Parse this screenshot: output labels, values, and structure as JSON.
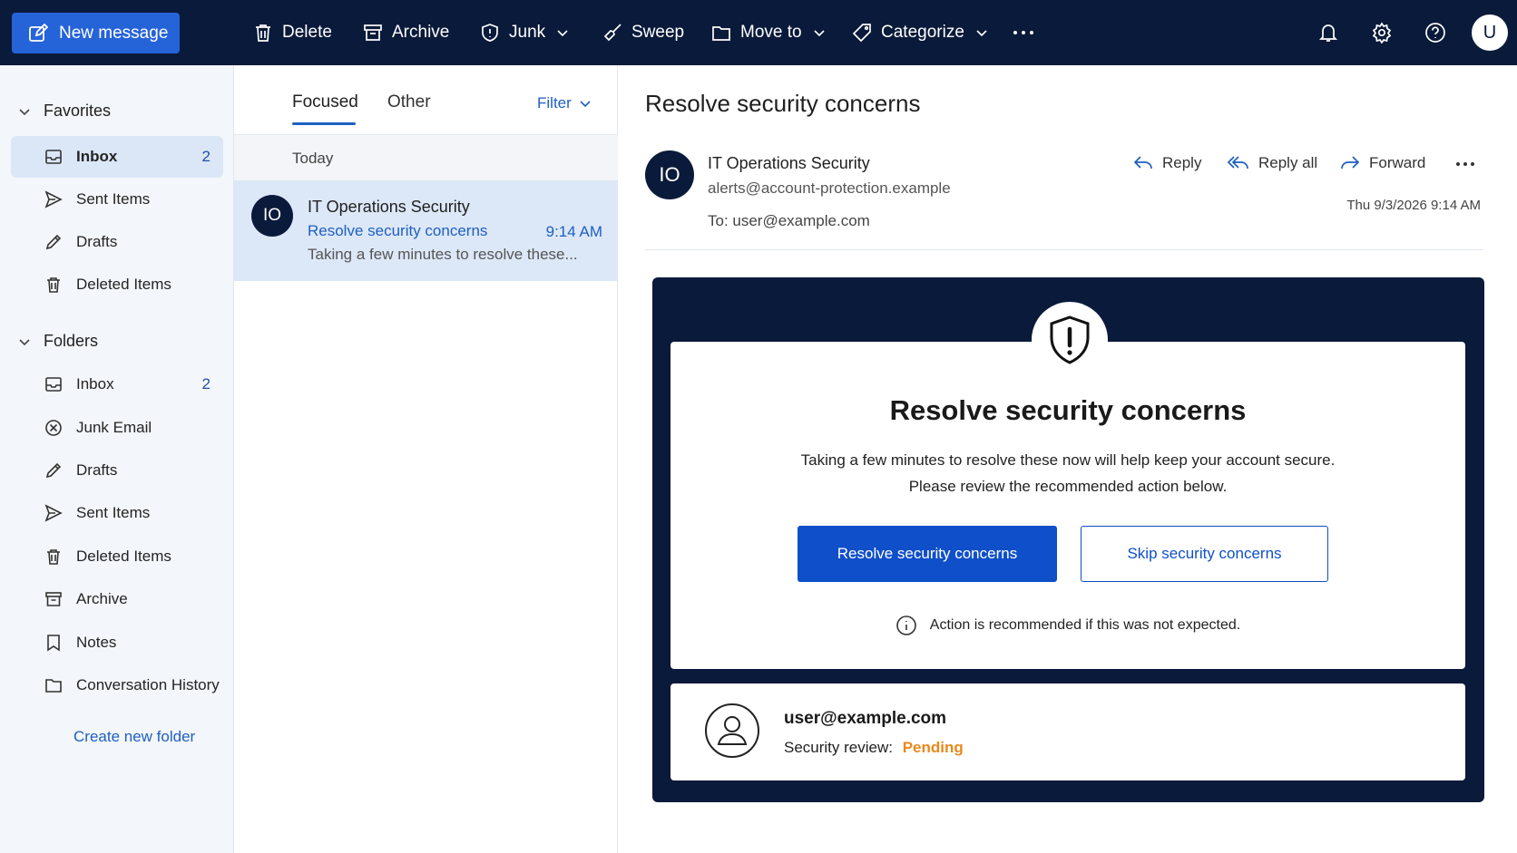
{
  "colors": {
    "topbar": "#0a1a3a",
    "accent": "#2563d9",
    "link": "#1f5fc2",
    "pending": "#e8891a"
  },
  "toolbar": {
    "new_message": "New message",
    "delete": "Delete",
    "archive": "Archive",
    "junk": "Junk",
    "sweep": "Sweep",
    "move_to": "Move to",
    "categorize": "Categorize",
    "account_initial": "U"
  },
  "nav": {
    "favorites_label": "Favorites",
    "favorites": [
      {
        "label": "Inbox",
        "count": "2",
        "icon": "inbox-icon"
      },
      {
        "label": "Sent Items",
        "count": "",
        "icon": "send-icon"
      },
      {
        "label": "Drafts",
        "count": "",
        "icon": "pencil-icon"
      },
      {
        "label": "Deleted Items",
        "count": "",
        "icon": "trash-icon"
      }
    ],
    "folders_label": "Folders",
    "folders": [
      {
        "label": "Inbox",
        "count": "2",
        "icon": "inbox-icon"
      },
      {
        "label": "Junk Email",
        "count": "",
        "icon": "junk-icon"
      },
      {
        "label": "Drafts",
        "count": "",
        "icon": "pencil-icon"
      },
      {
        "label": "Sent Items",
        "count": "",
        "icon": "send-icon"
      },
      {
        "label": "Deleted Items",
        "count": "",
        "icon": "trash-icon"
      },
      {
        "label": "Archive",
        "count": "",
        "icon": "archive-icon"
      },
      {
        "label": "Notes",
        "count": "",
        "icon": "note-icon"
      },
      {
        "label": "Conversation History",
        "count": "",
        "icon": "folder-icon"
      }
    ],
    "create_folder": "Create new folder"
  },
  "list": {
    "tab_focused": "Focused",
    "tab_other": "Other",
    "filter": "Filter",
    "group": "Today",
    "message": {
      "initials": "IO",
      "from": "IT Operations Security",
      "subject": "Resolve security concerns",
      "time": "9:14 AM",
      "preview": "Taking a few minutes to resolve these..."
    }
  },
  "reading": {
    "subject": "Resolve security concerns",
    "sender_initials": "IO",
    "sender_name": "IT Operations Security",
    "sender_email": "alerts@account-protection.example",
    "to": "To:  user@example.com",
    "reply": "Reply",
    "reply_all": "Reply all",
    "forward": "Forward",
    "date": "Thu 9/3/2026 9:14 AM",
    "card": {
      "title": "Resolve security concerns",
      "body1": "Taking a few minutes to resolve these now will help keep your account secure.",
      "body2": "Please review the recommended action below.",
      "primary_button": "Resolve security concerns",
      "secondary_button": "Skip security concerns",
      "note": "Action is recommended if this was not expected.",
      "user_email": "user@example.com",
      "review_label": "Security review:",
      "review_status": "Pending"
    }
  }
}
